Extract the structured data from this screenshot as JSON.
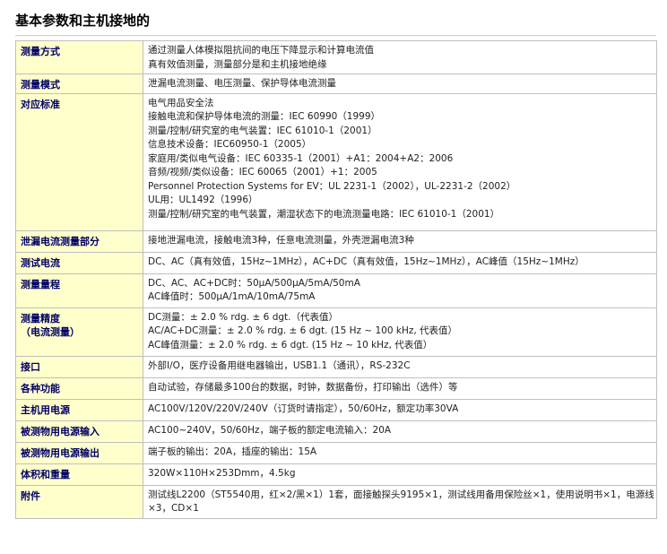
{
  "page": {
    "title": "基本参数和主机接地的"
  },
  "spec_table": {
    "rows": [
      {
        "label": [
          "测量方式"
        ],
        "lines": [
          "通过测量人体模拟阻抗间的电压下降显示和计算电流值",
          "真有效值测量，测量部分是和主机接地绝缘"
        ]
      },
      {
        "label": [
          "测量模式"
        ],
        "lines": [
          "泄漏电流测量、电压测量、保护导体电流测量"
        ]
      },
      {
        "label": [
          "对应标准"
        ],
        "lines": [
          "电气用品安全法",
          "接触电流和保护导体电流的测量：IEC 60990（1999）",
          "测量/控制/研究室的电气装置：IEC 61010-1（2001）",
          "信息技术设备：IEC60950-1（2005）",
          "家庭用/类似电气设备：IEC 60335-1（2001）+A1：2004+A2：2006",
          "音频/视频/类似设备：IEC 60065（2001）+1：2005",
          "Personnel Protection Systems for EV：UL 2231-1（2002），UL-2231-2（2002）",
          "UL用：UL1492（1996）",
          "测量/控制/研究室的电气装置，潮湿状态下的电流测量电路：IEC 61010-1（2001）"
        ]
      },
      {
        "label": [
          "泄漏电流测量部分"
        ],
        "lines": [
          "接地泄漏电流，接触电流3种，任意电流测量，外壳泄漏电流3种"
        ]
      },
      {
        "label": [
          "测试电流"
        ],
        "lines": [
          "DC、AC（真有效值，15Hz~1MHz），AC+DC（真有效值，15Hz~1MHz），AC峰值（15Hz~1MHz）"
        ]
      },
      {
        "label": [
          "测量量程"
        ],
        "lines": [
          "DC、AC、AC+DC时：50μA/500μA/5mA/50mA",
          "AC峰值时：500μA/1mA/10mA/75mA"
        ]
      },
      {
        "label": [
          "测量精度",
          "（电流测量）"
        ],
        "lines": [
          "DC测量：± 2.0 % rdg. ± 6 dgt.（代表值）",
          "AC/AC+DC测量：± 2.0 % rdg. ± 6 dgt. (15 Hz ~ 100 kHz, 代表值）",
          "AC峰值测量：± 2.0 % rdg. ± 6 dgt. (15 Hz ~ 10 kHz, 代表值）"
        ]
      },
      {
        "label": [
          "接口"
        ],
        "lines": [
          "外部I/O，医疗设备用继电器输出，USB1.1（通讯），RS-232C"
        ]
      },
      {
        "label": [
          "各种功能"
        ],
        "lines": [
          "自动试验，存储最多100台的数据，时钟，数据备份，打印输出（选件）等"
        ]
      },
      {
        "label": [
          "主机用电源"
        ],
        "lines": [
          "AC100V/120V/220V/240V（订货时请指定），50/60Hz，额定功率30VA"
        ]
      },
      {
        "label": [
          "被测物用电源输入"
        ],
        "lines": [
          "AC100~240V，50/60Hz，端子板的额定电流输入：20A"
        ]
      },
      {
        "label": [
          "被测物用电源输出"
        ],
        "lines": [
          "端子板的输出：20A，插座的输出：15A"
        ]
      },
      {
        "label": [
          "体积和重量"
        ],
        "lines": [
          "320W×110H×253Dmm，4.5kg"
        ]
      },
      {
        "label": [
          "附件"
        ],
        "lines": [
          "测试线L2200（ST5540用，红×2/黑×1）1套，面接触探头9195×1，测试线用备用保险丝×1，使用说明书×1，电源线×3，CD×1"
        ]
      }
    ]
  }
}
